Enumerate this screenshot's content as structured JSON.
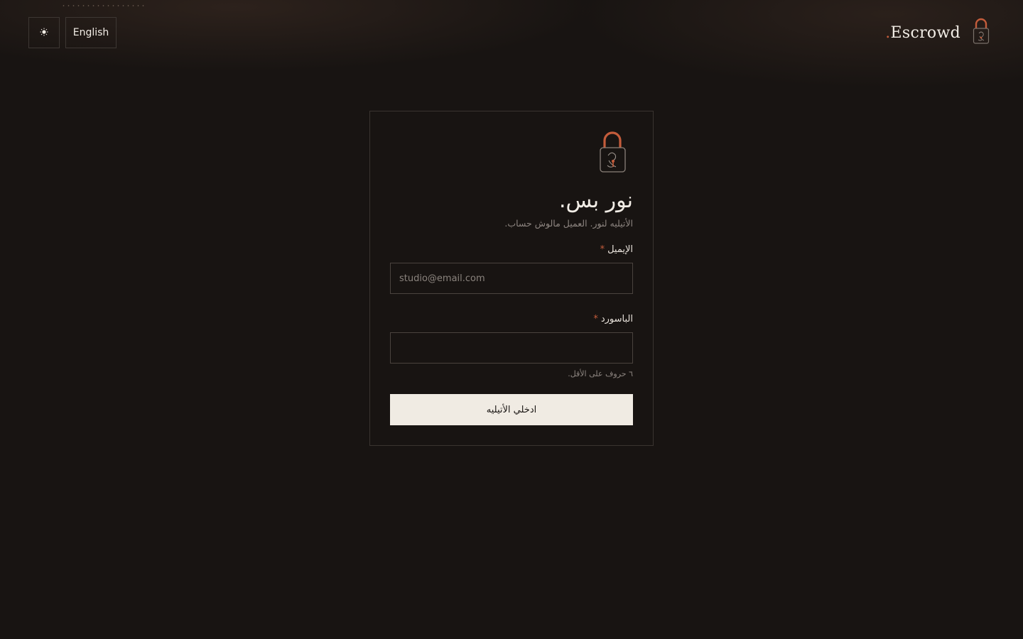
{
  "header": {
    "theme_toggle_icon": "sun-icon",
    "language_label": "English",
    "brand_name": "Escrowd",
    "brand_dot": ".",
    "logo_icon": "padlock-face-icon"
  },
  "card": {
    "logo_icon": "padlock-face-icon",
    "title": "نور بس.",
    "subtitle": "الأتيليه لنور. العميل مالوش حساب.",
    "email": {
      "label": "الإيميل",
      "required_mark": "*",
      "value": "",
      "placeholder": "studio@email.com"
    },
    "password": {
      "label": "الباسورد",
      "required_mark": "*",
      "value": "",
      "placeholder": "",
      "hint": "٦ حروف على الأقل."
    },
    "submit_label": "ادخلي الأتيليه"
  },
  "colors": {
    "background": "#181412",
    "accent": "#c45c3b",
    "text": "#f2ede6",
    "button_bg": "#f0ebe3",
    "border": "#3a3430"
  }
}
